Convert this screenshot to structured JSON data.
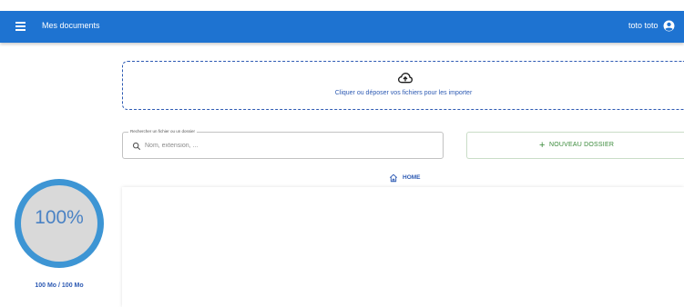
{
  "header": {
    "title": "Mes documents",
    "user_name": "toto toto",
    "menu_icon": "menu-icon",
    "account_icon": "account-circle-icon",
    "color": "#1e73d1"
  },
  "upload": {
    "icon": "cloud-upload-icon",
    "text": "Cliquer ou déposer vos fichiers pour les importer"
  },
  "search": {
    "label": "Rechercher un fichier ou un dossier",
    "placeholder": "Nom, extension, ...",
    "value": "",
    "icon": "search-icon"
  },
  "new_folder": {
    "label": "NOUVEAU DOSSIER",
    "icon": "plus-icon"
  },
  "breadcrumb": {
    "home_label": "HOME",
    "icon": "home-icon"
  },
  "storage": {
    "percent_label": "100%",
    "used_fraction": 1.0,
    "usage_text": "100 Mo / 100 Mo",
    "ring_color": "#3d95d4",
    "fill_color": "#d9d9d9"
  },
  "colors": {
    "accent": "#2d5ab3",
    "success": "#3a8a3a"
  }
}
